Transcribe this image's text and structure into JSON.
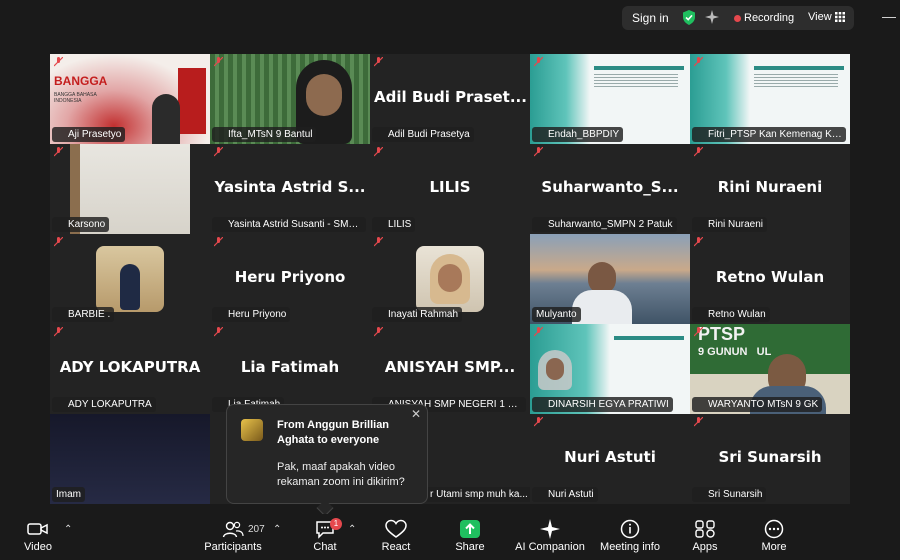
{
  "topbar": {
    "signin_label": "Sign in",
    "recording_label": "Recording",
    "view_label": "View",
    "minimize_label": "—"
  },
  "tiles": [
    {
      "name": "Aji Prasetyo",
      "big": ""
    },
    {
      "name": "Ifta_MTsN 9 Bantul",
      "big": ""
    },
    {
      "name": "Adil Budi Prasetya",
      "big": "Adil Budi Praset..."
    },
    {
      "name": "Endah_BBPDIY",
      "big": ""
    },
    {
      "name": "Fitri_PTSP Kan Kemenag Kot...",
      "big": ""
    },
    {
      "name": "Karsono",
      "big": ""
    },
    {
      "name": "Yasinta Astrid Susanti - SMP...",
      "big": "Yasinta Astrid S..."
    },
    {
      "name": "LILIS",
      "big": "LILIS"
    },
    {
      "name": "Suharwanto_SMPN 2 Patuk",
      "big": "Suharwanto_S..."
    },
    {
      "name": "Rini Nuraeni",
      "big": "Rini Nuraeni"
    },
    {
      "name": "BARBIE .",
      "big": ""
    },
    {
      "name": "Heru Priyono",
      "big": "Heru Priyono"
    },
    {
      "name": "Inayati Rahmah",
      "big": ""
    },
    {
      "name": "Mulyanto",
      "big": ""
    },
    {
      "name": "Retno Wulan",
      "big": "Retno Wulan"
    },
    {
      "name": "ADY LOKAPUTRA",
      "big": "ADY LOKAPUTRA"
    },
    {
      "name": "Lia Fatimah",
      "big": "Lia Fatimah"
    },
    {
      "name": "ANISYAH SMP NEGERI 1 BA...",
      "big": "ANISYAH SMP..."
    },
    {
      "name": "DINARSIH EGYA PRATIWI",
      "big": ""
    },
    {
      "name": "WARYANTO MTsN 9 GK",
      "big": ""
    },
    {
      "name": "Imam",
      "big": ""
    },
    {
      "name": "",
      "big": ""
    },
    {
      "name": "r Utami smp muh ka...",
      "big": ""
    },
    {
      "name": "Nuri Astuti",
      "big": "Nuri Astuti"
    },
    {
      "name": "Sri Sunarsih",
      "big": "Sri Sunarsih"
    }
  ],
  "slide_text": {
    "bangga_title": "BANGGA",
    "bangga_sub": "BANGGA BAHASA INDONESIA",
    "ptsp": "PTSP",
    "gunung": "9 GUNUN   UL"
  },
  "chat_popup": {
    "from": "From Anggun Brillian Aghata to everyone",
    "message": "Pak, maaf apakah video rekaman zoom ini dikirim?",
    "close": "✕"
  },
  "toolbar": {
    "video_label": "Video",
    "participants_label": "Participants",
    "participants_count": "207",
    "chat_label": "Chat",
    "chat_badge": "1",
    "react_label": "React",
    "share_label": "Share",
    "ai_label": "AI Companion",
    "meeting_info_label": "Meeting info",
    "apps_label": "Apps",
    "more_label": "More"
  },
  "colors": {
    "active_speaker": "#3fbf59",
    "share_green": "#1fbf5f",
    "recording_red": "#e5484d"
  }
}
